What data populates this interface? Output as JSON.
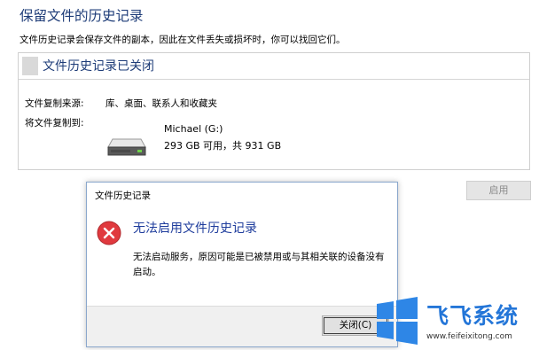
{
  "page": {
    "title": "保留文件的历史记录",
    "description": "文件历史记录会保存文件的副本，因此在文件丢失或损坏时，你可以找回它们。"
  },
  "status_panel": {
    "title": "文件历史记录已关闭",
    "source_label": "文件复制来源:",
    "source_value": "库、桌面、联系人和收藏夹",
    "dest_label": "将文件复制到:",
    "drive_name": "Michael (G:)",
    "drive_space": "293 GB 可用，共 931 GB"
  },
  "enable_button": {
    "label": "启用",
    "enabled": false
  },
  "dialog": {
    "title": "文件历史记录",
    "heading": "无法启用文件历史记录",
    "message": "无法启动服务，原因可能是已被禁用或与其相关联的设备没有启动。",
    "close_button": "关闭(C)",
    "icon": "error-icon"
  },
  "watermark": {
    "brand": "飞飞系统",
    "url": "www.feifeixitong.com"
  },
  "colors": {
    "heading_blue": "#1e3c78",
    "dialog_heading_blue": "#1e3c9c",
    "error_red": "#e0393e",
    "brand_blue": "#2476d8"
  }
}
